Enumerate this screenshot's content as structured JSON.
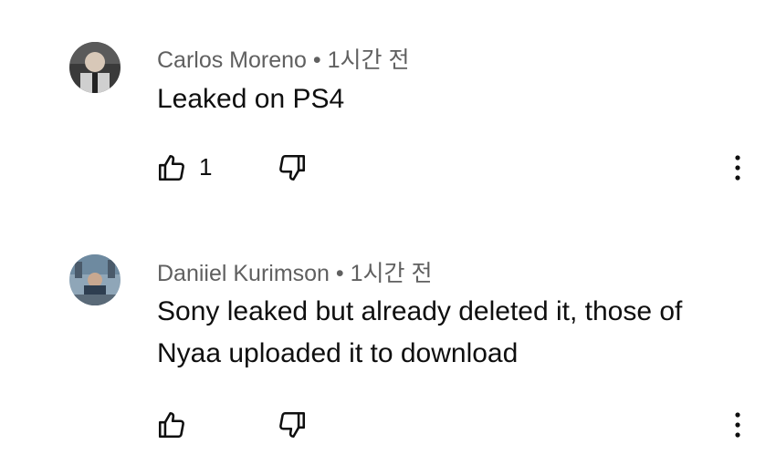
{
  "comments": [
    {
      "author": "Carlos Moreno",
      "separator": "•",
      "time": "1시간 전",
      "text": "Leaked on PS4",
      "likes": "1",
      "avatar_colors": [
        "#2b2b2b",
        "#d9d9d9"
      ]
    },
    {
      "author": "Daniiel Kurimson",
      "separator": "•",
      "time": "1시간 전",
      "text": "Sony leaked but already deleted it, those of Nyaa uploaded it to download",
      "likes": "",
      "avatar_colors": [
        "#6a7f8f",
        "#3a4a5a"
      ]
    }
  ],
  "icons": {
    "like": "thumb-up-icon",
    "dislike": "thumb-down-icon",
    "more": "more-vert-icon"
  }
}
